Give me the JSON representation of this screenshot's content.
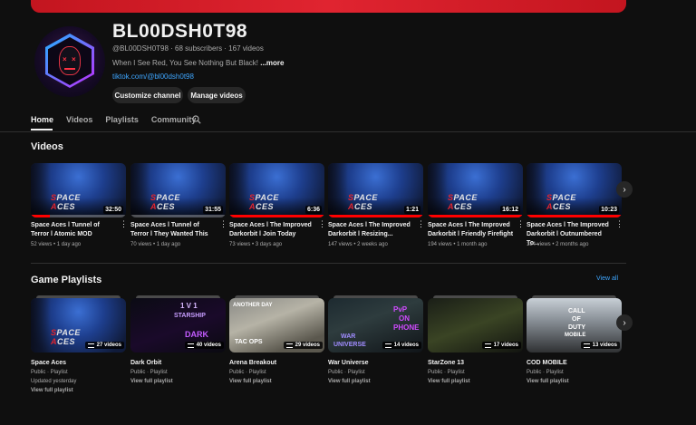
{
  "channel": {
    "name": "BL00DSH0T98",
    "handle_meta": "@BL00DSH0T98 · 68 subscribers · 167 videos",
    "description": "When I See Red, You See Nothing But Black!",
    "more_label": "...more",
    "link": "tiktok.com/@bl00dsh0t98",
    "customize_label": "Customize channel",
    "manage_label": "Manage videos"
  },
  "tabs": [
    {
      "label": "Home",
      "active": true
    },
    {
      "label": "Videos",
      "active": false
    },
    {
      "label": "Playlists",
      "active": false
    },
    {
      "label": "Community",
      "active": false
    }
  ],
  "videos_section": {
    "title": "Videos",
    "items": [
      {
        "title": "Space Aces l Tunnel of Terror l Atomic MOD",
        "meta": "52 views • 1 day ago",
        "duration": "32:50",
        "progress": 0.2
      },
      {
        "title": "Space Aces l Tunnel of Terror l They Wanted This",
        "meta": "70 views • 1 day ago",
        "duration": "31:55",
        "progress": 0.0
      },
      {
        "title": "Space Aces l The Improved Darkorbit l Join Today",
        "meta": "73 views • 3 days ago",
        "duration": "6:36",
        "progress": 1.0
      },
      {
        "title": "Space Aces l The Improved Darkorbit l Resizing...",
        "meta": "147 views • 2 weeks ago",
        "duration": "1:21",
        "progress": 1.0
      },
      {
        "title": "Space Aces l The Improved Darkorbit l Friendly Firefight",
        "meta": "194 views • 1 month ago",
        "duration": "16:12",
        "progress": 1.0
      },
      {
        "title": "Space Aces l The Improved Darkorbit l Outnumbered To...",
        "meta": "184 views • 2 months ago",
        "duration": "10:23",
        "progress": 1.0
      }
    ]
  },
  "playlists_section": {
    "title": "Game Playlists",
    "view_all": "View all",
    "items": [
      {
        "title": "Space Aces",
        "sub": "Public · Playlist",
        "updated": "Updated yesterday",
        "link": "View full playlist",
        "count": "27 videos"
      },
      {
        "title": "Dark Orbit",
        "sub": "Public · Playlist",
        "updated": "",
        "link": "View full playlist",
        "count": "40 videos",
        "overlay": [
          "1 V 1",
          "STARSHIP",
          "DARK"
        ]
      },
      {
        "title": "Arena Breakout",
        "sub": "Public · Playlist",
        "updated": "",
        "link": "View full playlist",
        "count": "29 videos",
        "overlay": [
          "ANOTHER DAY",
          "TAC OPS"
        ]
      },
      {
        "title": "War Universe",
        "sub": "Public · Playlist",
        "updated": "",
        "link": "View full playlist",
        "count": "14 videos",
        "overlay": [
          "PvP",
          "ON",
          "PHONE",
          "WAR",
          "UNIVERSE"
        ]
      },
      {
        "title": "StarZone 13",
        "sub": "Public · Playlist",
        "updated": "",
        "link": "View full playlist",
        "count": "17 videos"
      },
      {
        "title": "COD MOBILE",
        "sub": "Public · Playlist",
        "updated": "",
        "link": "View full playlist",
        "count": "13 videos",
        "overlay": [
          "CALL",
          "OF",
          "DUTY",
          "MOBILE"
        ]
      }
    ]
  },
  "thumb_logo": {
    "part1": "S",
    "part2": "PACE",
    "part3": "A",
    "part4": "CES"
  },
  "colors": {
    "accent": "#ff0000",
    "link": "#3ea6ff",
    "banner": "#e02430",
    "background": "#0f0f0f"
  }
}
